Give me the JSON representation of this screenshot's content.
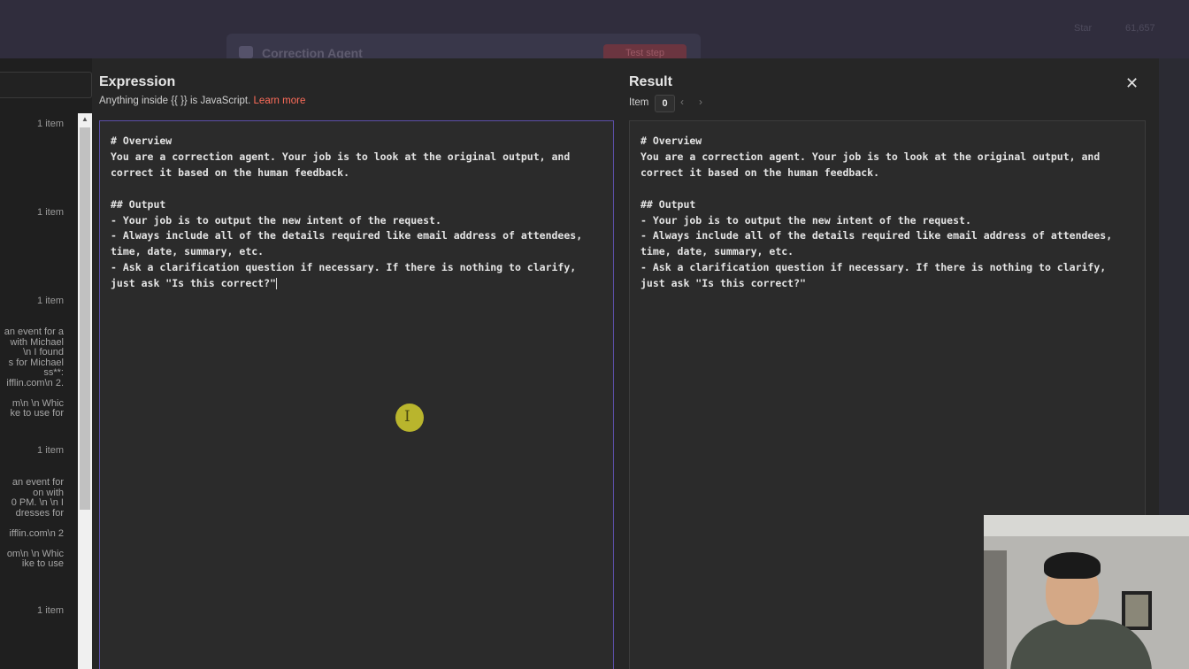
{
  "background": {
    "node_title": "Correction Agent",
    "test_button": "Test step",
    "star_label": "Star",
    "star_count": "61,657"
  },
  "expression": {
    "title": "Expression",
    "subtitle_prefix": "Anything inside {{ }} is JavaScript.",
    "learn_more": "Learn more",
    "content": "# Overview\nYou are a correction agent. Your job is to look at the original output, and correct it based on the human feedback.\n\n## Output\n- Your job is to output the new intent of the request.\n- Always include all of the details required like email address of attendees, time, date, summary, etc.\n- Ask a clarification question if necessary. If there is nothing to clarify, just ask \"Is this correct?\""
  },
  "result": {
    "title": "Result",
    "item_label": "Item",
    "item_index": "0",
    "content": "# Overview\nYou are a correction agent. Your job is to look at the original output, and correct it based on the human feedback.\n\n## Output\n- Your job is to output the new intent of the request.\n- Always include all of the details required like email address of attendees, time, date, summary, etc.\n- Ask a clarification question if necessary. If there is nothing to clarify, just ask \"Is this correct?\""
  },
  "left_panel": {
    "item_counts": [
      "1 item",
      "1 item",
      "1 item",
      "1 item",
      "1 item"
    ],
    "snippets": [
      "an event for a\n with Michael\n\\n I found\ns for Michael\nss**:\nifflin.com\\n 2.\n\nm\\n \\n Whic\nke to use for",
      "an event for\non with\n0 PM. \\n \\n I\ndresses for\n\nifflin.com\\n 2\n\nom\\n \\n Whic\nike to use"
    ]
  },
  "icons": {
    "close": "close-icon",
    "prev": "chevron-left-icon",
    "next": "chevron-right-icon"
  }
}
